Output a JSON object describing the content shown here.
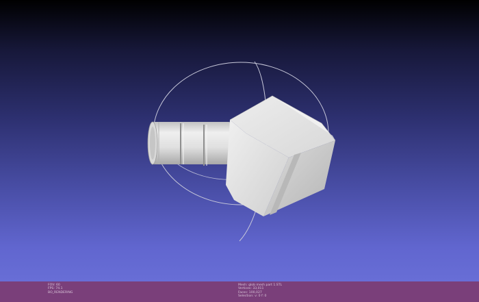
{
  "viewport": {
    "colors": {
      "background_top": "#000000",
      "background_bottom": "#686ed6",
      "trackball": "#c9c9d9",
      "trackball_axis": "#d0d0e0",
      "mesh_light": "#e4e4e4",
      "mesh_mid": "#cfcfcf",
      "mesh_dark": "#a9a9a9"
    },
    "mesh_icon": "3d-mesh-model",
    "trackball_icon": "trackball-gizmo"
  },
  "statusbar": {
    "color": "#7a3f7a",
    "left_lines": [
      "FOV: 60",
      "FPS:   74.1",
      "BO_RENDERING"
    ],
    "right_lines": [
      "Mesh: glob mesh part 1.STL",
      "Vertices: 33,011",
      "Faces: 100,027",
      "Selection: v: 0 f: 0"
    ]
  }
}
